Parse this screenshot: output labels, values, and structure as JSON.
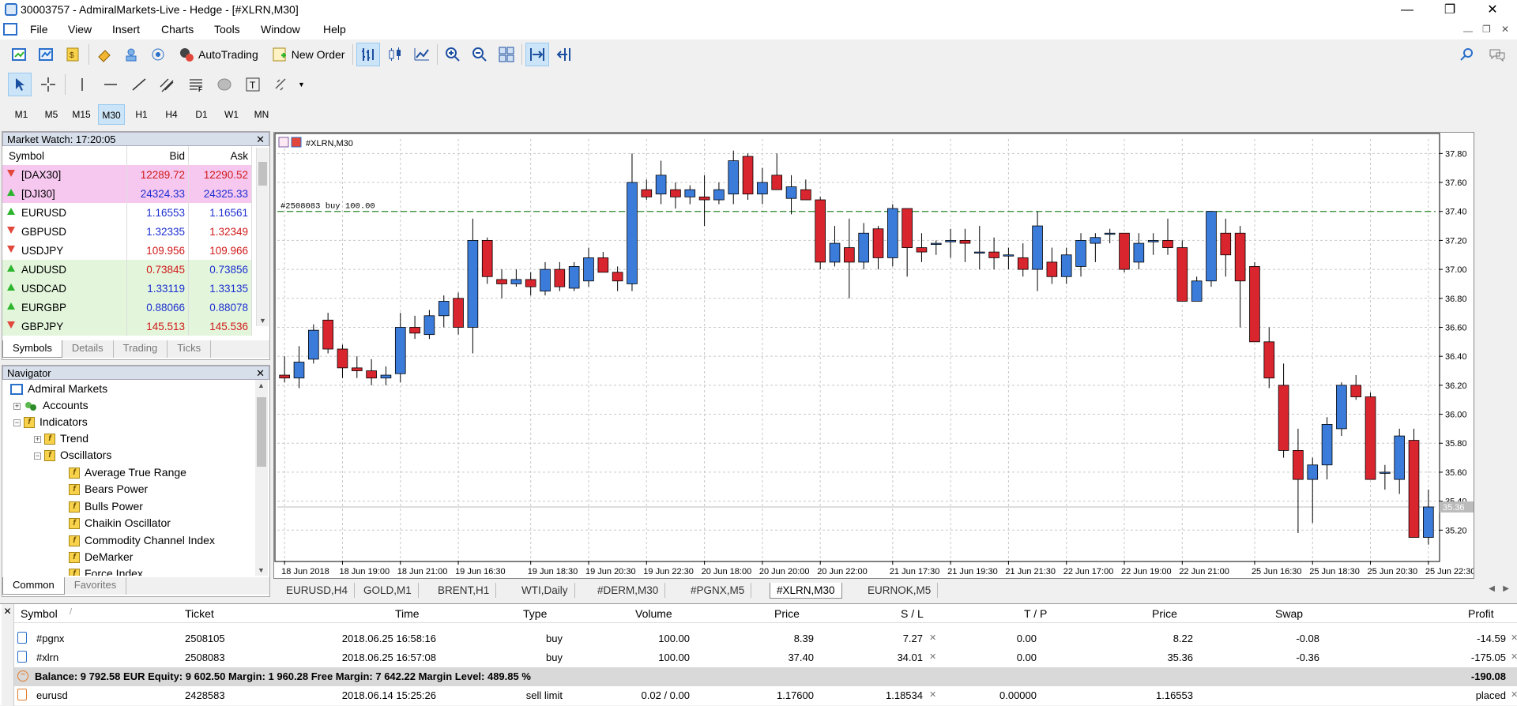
{
  "window": {
    "title": "30003757 - AdmiralMarkets-Live - Hedge - [#XLRN,M30]",
    "min": "—",
    "max": "❐",
    "close": "✕"
  },
  "menu": [
    "File",
    "View",
    "Insert",
    "Charts",
    "Tools",
    "Window",
    "Help"
  ],
  "toolbar": {
    "autotrading": "AutoTrading",
    "new_order": "New Order"
  },
  "timeframes": [
    "M1",
    "M5",
    "M15",
    "M30",
    "H1",
    "H4",
    "D1",
    "W1",
    "MN"
  ],
  "active_timeframe": "M30",
  "market_watch": {
    "title": "Market Watch: 17:20:05",
    "headers": [
      "Symbol",
      "Bid",
      "Ask"
    ],
    "rows": [
      {
        "symbol": "[DAX30]",
        "bid": "12289.72",
        "ask": "12290.52",
        "dir": "down",
        "bg": "#f6c8f0",
        "bidc": "#d01818",
        "askc": "#d01818"
      },
      {
        "symbol": "[DJI30]",
        "bid": "24324.33",
        "ask": "24325.33",
        "dir": "up",
        "bg": "#f6c8f0",
        "bidc": "#1d2fd0",
        "askc": "#1d2fd0"
      },
      {
        "symbol": "EURUSD",
        "bid": "1.16553",
        "ask": "1.16561",
        "dir": "up",
        "bg": "#ffffff",
        "bidc": "#1d2fd0",
        "askc": "#1d2fd0"
      },
      {
        "symbol": "GBPUSD",
        "bid": "1.32335",
        "ask": "1.32349",
        "dir": "down",
        "bg": "#ffffff",
        "bidc": "#1d2fd0",
        "askc": "#d01818"
      },
      {
        "symbol": "USDJPY",
        "bid": "109.956",
        "ask": "109.966",
        "dir": "down",
        "bg": "#ffffff",
        "bidc": "#d01818",
        "askc": "#d01818"
      },
      {
        "symbol": "AUDUSD",
        "bid": "0.73845",
        "ask": "0.73856",
        "dir": "up",
        "bg": "#e3f6dc",
        "bidc": "#d01818",
        "askc": "#1d2fd0"
      },
      {
        "symbol": "USDCAD",
        "bid": "1.33119",
        "ask": "1.33135",
        "dir": "up",
        "bg": "#e3f6dc",
        "bidc": "#1d2fd0",
        "askc": "#1d2fd0"
      },
      {
        "symbol": "EURGBP",
        "bid": "0.88066",
        "ask": "0.88078",
        "dir": "up",
        "bg": "#e3f6dc",
        "bidc": "#1d2fd0",
        "askc": "#1d2fd0"
      },
      {
        "symbol": "GBPJPY",
        "bid": "145.513",
        "ask": "145.536",
        "dir": "down",
        "bg": "#e3f6dc",
        "bidc": "#d01818",
        "askc": "#d01818"
      }
    ],
    "tabs": [
      "Symbols",
      "Details",
      "Trading",
      "Ticks"
    ]
  },
  "navigator": {
    "title": "Navigator",
    "items": [
      "Admiral Markets",
      "Accounts",
      "Indicators",
      "Trend",
      "Oscillators",
      "Average True Range",
      "Bears Power",
      "Bulls Power",
      "Chaikin Oscillator",
      "Commodity Channel Index",
      "DeMarker",
      "Force Index"
    ],
    "tabs": [
      "Common",
      "Favorites"
    ]
  },
  "chart": {
    "label": "#XLRN,M30",
    "order_line": "#2508083 buy 100.00",
    "price_tag": "35.36"
  },
  "chart_data": {
    "type": "candlestick",
    "symbol": "#XLRN",
    "timeframe": "M30",
    "ylim": [
      35.0,
      37.9
    ],
    "y_ticks": [
      "37.80",
      "37.60",
      "37.40",
      "37.20",
      "37.00",
      "36.80",
      "36.60",
      "36.40",
      "36.20",
      "36.00",
      "35.80",
      "35.60",
      "35.40",
      "35.20"
    ],
    "x_ticks": [
      "18 Jun 2018",
      "18 Jun 19:00",
      "18 Jun 21:00",
      "19 Jun 16:30",
      "19 Jun 18:30",
      "19 Jun 20:30",
      "19 Jun 22:30",
      "20 Jun 18:00",
      "20 Jun 20:00",
      "20 Jun 22:00",
      "21 Jun 17:30",
      "21 Jun 19:30",
      "21 Jun 21:30",
      "22 Jun 17:00",
      "22 Jun 19:00",
      "22 Jun 21:00",
      "25 Jun 16:30",
      "25 Jun 18:30",
      "25 Jun 20:30",
      "25 Jun 22:30"
    ],
    "order_level": 37.4,
    "current_price": 35.36,
    "candles": [
      [
        36.27,
        36.4,
        36.22,
        36.25
      ],
      [
        36.25,
        36.47,
        36.18,
        36.36
      ],
      [
        36.38,
        36.62,
        36.35,
        36.58
      ],
      [
        36.65,
        36.7,
        36.42,
        36.45
      ],
      [
        36.45,
        36.48,
        36.25,
        36.32
      ],
      [
        36.32,
        36.4,
        36.25,
        36.3
      ],
      [
        36.3,
        36.38,
        36.2,
        36.25
      ],
      [
        36.25,
        36.33,
        36.2,
        36.27
      ],
      [
        36.28,
        36.7,
        36.22,
        36.6
      ],
      [
        36.6,
        36.68,
        36.52,
        36.56
      ],
      [
        36.55,
        36.72,
        36.52,
        36.68
      ],
      [
        36.68,
        36.82,
        36.6,
        36.78
      ],
      [
        36.8,
        36.84,
        36.55,
        36.6
      ],
      [
        36.6,
        37.35,
        36.42,
        37.2
      ],
      [
        37.2,
        37.22,
        36.9,
        36.95
      ],
      [
        36.93,
        37.0,
        36.8,
        36.9
      ],
      [
        36.9,
        37.0,
        36.88,
        36.93
      ],
      [
        36.93,
        36.98,
        36.82,
        36.88
      ],
      [
        36.85,
        37.05,
        36.82,
        37.0
      ],
      [
        37.0,
        37.05,
        36.85,
        36.88
      ],
      [
        36.87,
        37.05,
        36.85,
        37.02
      ],
      [
        36.92,
        37.15,
        36.88,
        37.08
      ],
      [
        37.08,
        37.12,
        36.98,
        36.98
      ],
      [
        36.98,
        37.02,
        36.85,
        36.92
      ],
      [
        36.9,
        37.8,
        36.85,
        37.6
      ],
      [
        37.55,
        37.62,
        37.48,
        37.5
      ],
      [
        37.52,
        37.75,
        37.45,
        37.65
      ],
      [
        37.55,
        37.6,
        37.42,
        37.5
      ],
      [
        37.5,
        37.58,
        37.45,
        37.55
      ],
      [
        37.5,
        37.65,
        37.3,
        37.48
      ],
      [
        37.48,
        37.6,
        37.45,
        37.55
      ],
      [
        37.52,
        37.82,
        37.45,
        37.75
      ],
      [
        37.78,
        37.8,
        37.48,
        37.52
      ],
      [
        37.52,
        37.7,
        37.45,
        37.6
      ],
      [
        37.65,
        37.8,
        37.55,
        37.55
      ],
      [
        37.49,
        37.65,
        37.38,
        37.57
      ],
      [
        37.55,
        37.62,
        37.48,
        37.48
      ],
      [
        37.48,
        37.5,
        37.0,
        37.05
      ],
      [
        37.05,
        37.3,
        37.02,
        37.18
      ],
      [
        37.15,
        37.35,
        36.8,
        37.05
      ],
      [
        37.05,
        37.32,
        37.0,
        37.25
      ],
      [
        37.28,
        37.3,
        37.0,
        37.08
      ],
      [
        37.08,
        37.45,
        37.02,
        37.42
      ],
      [
        37.42,
        37.42,
        36.95,
        37.15
      ],
      [
        37.15,
        37.25,
        37.05,
        37.12
      ],
      [
        37.18,
        37.2,
        37.1,
        37.18
      ],
      [
        37.19,
        37.28,
        37.08,
        37.2
      ],
      [
        37.2,
        37.28,
        37.05,
        37.18
      ],
      [
        37.12,
        37.3,
        37.0,
        37.12
      ],
      [
        37.12,
        37.22,
        37.0,
        37.08
      ],
      [
        37.1,
        37.15,
        37.0,
        37.1
      ],
      [
        37.08,
        37.18,
        36.95,
        37.0
      ],
      [
        37.0,
        37.4,
        36.85,
        37.3
      ],
      [
        37.05,
        37.15,
        36.9,
        36.95
      ],
      [
        36.95,
        37.15,
        36.9,
        37.1
      ],
      [
        37.02,
        37.25,
        36.95,
        37.2
      ],
      [
        37.18,
        37.25,
        37.05,
        37.22
      ],
      [
        37.25,
        37.28,
        37.18,
        37.25
      ],
      [
        37.25,
        37.25,
        36.98,
        37.0
      ],
      [
        37.05,
        37.25,
        37.0,
        37.18
      ],
      [
        37.19,
        37.25,
        37.1,
        37.2
      ],
      [
        37.2,
        37.35,
        37.1,
        37.15
      ],
      [
        37.15,
        37.2,
        36.78,
        36.78
      ],
      [
        36.78,
        36.95,
        36.78,
        36.92
      ],
      [
        36.92,
        37.4,
        36.88,
        37.4
      ],
      [
        37.25,
        37.35,
        36.95,
        37.1
      ],
      [
        37.25,
        37.3,
        36.6,
        36.92
      ],
      [
        37.02,
        37.05,
        36.5,
        36.5
      ],
      [
        36.5,
        36.6,
        36.18,
        36.25
      ],
      [
        36.2,
        36.35,
        35.7,
        35.75
      ],
      [
        35.75,
        35.9,
        35.18,
        35.55
      ],
      [
        35.55,
        35.7,
        35.25,
        35.65
      ],
      [
        35.65,
        35.98,
        35.55,
        35.93
      ],
      [
        35.9,
        36.22,
        35.85,
        36.2
      ],
      [
        36.2,
        36.27,
        36.1,
        36.12
      ],
      [
        36.12,
        36.15,
        35.55,
        35.55
      ],
      [
        35.6,
        35.65,
        35.48,
        35.6
      ],
      [
        35.55,
        35.9,
        35.45,
        35.85
      ],
      [
        35.82,
        35.9,
        35.15,
        35.15
      ],
      [
        35.15,
        35.48,
        35.1,
        35.36
      ]
    ]
  },
  "chart_tabs": [
    "EURUSD,H4",
    "GOLD,M1",
    "BRENT,H1",
    "WTI,Daily",
    "#DERM,M30",
    "#PGNX,M5",
    "#XLRN,M30",
    "EURNOK,M5"
  ],
  "active_chart_tab": "#XLRN,M30",
  "terminal": {
    "headers": [
      "Symbol",
      "/",
      "Ticket",
      "Time",
      "Type",
      "Volume",
      "Price",
      "S / L",
      "T / P",
      "Price",
      "Swap",
      "Profit"
    ],
    "rows": [
      {
        "symbol": "#pgnx",
        "ticket": "2508105",
        "time": "2018.06.25 16:58:16",
        "type": "buy",
        "volume": "100.00",
        "price": "8.39",
        "sl": "7.27",
        "tp": "0.00",
        "cur": "8.22",
        "swap": "-0.08",
        "profit": "-14.59"
      },
      {
        "symbol": "#xlrn",
        "ticket": "2508083",
        "time": "2018.06.25 16:57:08",
        "type": "buy",
        "volume": "100.00",
        "price": "37.40",
        "sl": "34.01",
        "tp": "0.00",
        "cur": "35.36",
        "swap": "-0.36",
        "profit": "-175.05"
      },
      {
        "symbol": "eurusd",
        "ticket": "2428583",
        "time": "2018.06.14 15:25:26",
        "type": "sell limit",
        "volume": "0.02 / 0.00",
        "price": "1.17600",
        "sl": "1.18534",
        "tp": "0.00000",
        "cur": "1.16553",
        "swap": "",
        "profit": "placed"
      }
    ],
    "balance_line": "Balance: 9 792.58 EUR  Equity: 9 602.50  Margin: 1 960.28  Free Margin: 7 642.22  Margin Level: 489.85 %",
    "balance_profit": "-190.08"
  },
  "colors": {
    "bull": "#3b7bd9",
    "bear": "#d8252e",
    "grid": "#c8c8c8",
    "order_line": "#2d8a2d"
  }
}
